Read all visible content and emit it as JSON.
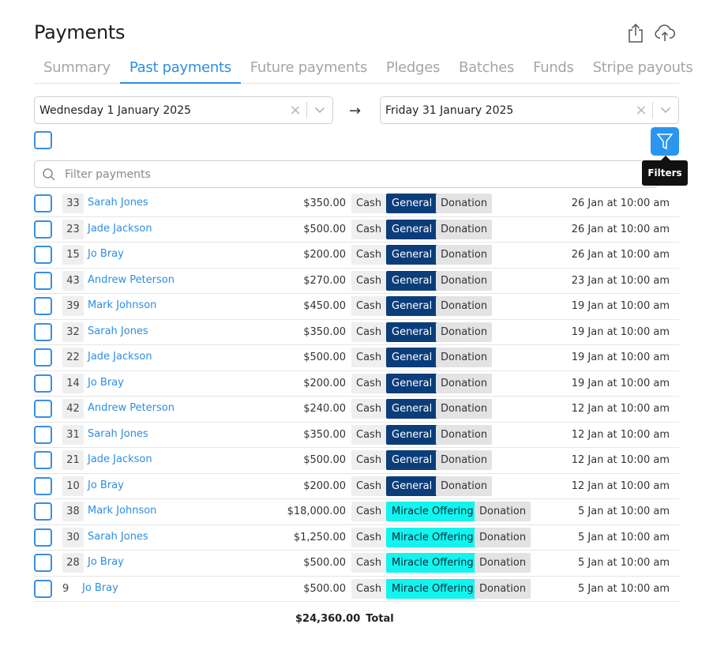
{
  "header": {
    "title": "Payments",
    "share_icon": "share-icon",
    "upload_icon": "cloud-upload-icon"
  },
  "tabs": [
    {
      "label": "Summary",
      "active": false
    },
    {
      "label": "Past payments",
      "active": true
    },
    {
      "label": "Future payments",
      "active": false
    },
    {
      "label": "Pledges",
      "active": false
    },
    {
      "label": "Batches",
      "active": false
    },
    {
      "label": "Funds",
      "active": false
    },
    {
      "label": "Stripe payouts",
      "active": false
    }
  ],
  "date_range": {
    "start": "Wednesday 1 January 2025",
    "end": "Friday 31 January 2025",
    "arrow": "→",
    "clear_glyph": "×"
  },
  "filters": {
    "button_icon": "filter-icon",
    "tooltip": "Filters"
  },
  "search": {
    "placeholder": "Filter payments"
  },
  "colors": {
    "accent": "#2d8ee3",
    "general_fund": "#0b3d7a",
    "miracle_fund": "#12f4ee"
  },
  "payments": [
    {
      "id": "33",
      "name": "Sarah Jones",
      "amount": "$350.00",
      "method": "Cash",
      "fund": "General",
      "type": "Donation",
      "date": "26 Jan at 10:00 am"
    },
    {
      "id": "23",
      "name": "Jade Jackson",
      "amount": "$500.00",
      "method": "Cash",
      "fund": "General",
      "type": "Donation",
      "date": "26 Jan at 10:00 am"
    },
    {
      "id": "15",
      "name": "Jo Bray",
      "amount": "$200.00",
      "method": "Cash",
      "fund": "General",
      "type": "Donation",
      "date": "26 Jan at 10:00 am"
    },
    {
      "id": "43",
      "name": "Andrew Peterson",
      "amount": "$270.00",
      "method": "Cash",
      "fund": "General",
      "type": "Donation",
      "date": "23 Jan at 10:00 am"
    },
    {
      "id": "39",
      "name": "Mark Johnson",
      "amount": "$450.00",
      "method": "Cash",
      "fund": "General",
      "type": "Donation",
      "date": "19 Jan at 10:00 am"
    },
    {
      "id": "32",
      "name": "Sarah Jones",
      "amount": "$350.00",
      "method": "Cash",
      "fund": "General",
      "type": "Donation",
      "date": "19 Jan at 10:00 am"
    },
    {
      "id": "22",
      "name": "Jade Jackson",
      "amount": "$500.00",
      "method": "Cash",
      "fund": "General",
      "type": "Donation",
      "date": "19 Jan at 10:00 am"
    },
    {
      "id": "14",
      "name": "Jo Bray",
      "amount": "$200.00",
      "method": "Cash",
      "fund": "General",
      "type": "Donation",
      "date": "19 Jan at 10:00 am"
    },
    {
      "id": "42",
      "name": "Andrew Peterson",
      "amount": "$240.00",
      "method": "Cash",
      "fund": "General",
      "type": "Donation",
      "date": "12 Jan at 10:00 am"
    },
    {
      "id": "31",
      "name": "Sarah Jones",
      "amount": "$350.00",
      "method": "Cash",
      "fund": "General",
      "type": "Donation",
      "date": "12 Jan at 10:00 am"
    },
    {
      "id": "21",
      "name": "Jade Jackson",
      "amount": "$500.00",
      "method": "Cash",
      "fund": "General",
      "type": "Donation",
      "date": "12 Jan at 10:00 am"
    },
    {
      "id": "10",
      "name": "Jo Bray",
      "amount": "$200.00",
      "method": "Cash",
      "fund": "General",
      "type": "Donation",
      "date": "12 Jan at 10:00 am"
    },
    {
      "id": "38",
      "name": "Mark Johnson",
      "amount": "$18,000.00",
      "method": "Cash",
      "fund": "Miracle Offering",
      "type": "Donation",
      "date": "5 Jan at 10:00 am"
    },
    {
      "id": "30",
      "name": "Sarah Jones",
      "amount": "$1,250.00",
      "method": "Cash",
      "fund": "Miracle Offering",
      "type": "Donation",
      "date": "5 Jan at 10:00 am"
    },
    {
      "id": "28",
      "name": "Jo Bray",
      "amount": "$500.00",
      "method": "Cash",
      "fund": "Miracle Offering",
      "type": "Donation",
      "date": "5 Jan at 10:00 am"
    },
    {
      "id": "9",
      "name": "Jo Bray",
      "amount": "$500.00",
      "method": "Cash",
      "fund": "Miracle Offering",
      "type": "Donation",
      "date": "5 Jan at 10:00 am"
    }
  ],
  "totals": {
    "amount": "$24,360.00",
    "label": "Total"
  }
}
